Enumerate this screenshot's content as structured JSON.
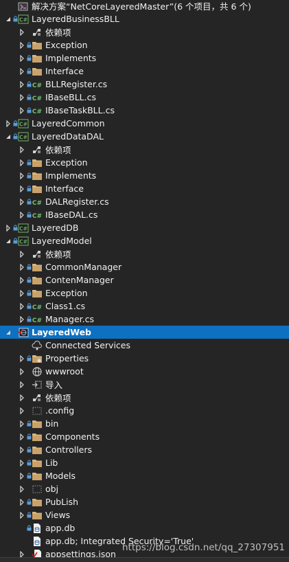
{
  "colors": {
    "background": "#252526",
    "selection": "#0e70c0",
    "folder": "#dcb67a",
    "csharp": "#6fc36f",
    "project": "#68a063"
  },
  "watermark": "https://blog.csdn.net/qq_27307951",
  "tree": [
    {
      "label": "解决方案“NetCoreLayeredMaster”(6 个项目，共 6 个)",
      "icon": "solution-icon",
      "depth": 0,
      "arrow": "none",
      "lock": false
    },
    {
      "label": "LayeredBusinessBLL",
      "icon": "csharp-project-icon",
      "depth": 0,
      "arrow": "expanded",
      "lock": true
    },
    {
      "label": "依赖项",
      "icon": "dependencies-icon",
      "depth": 1,
      "arrow": "collapsed",
      "lock": false
    },
    {
      "label": "Exception",
      "icon": "folder-icon",
      "depth": 1,
      "arrow": "collapsed",
      "lock": true
    },
    {
      "label": "Implements",
      "icon": "folder-icon",
      "depth": 1,
      "arrow": "collapsed",
      "lock": true
    },
    {
      "label": "Interface",
      "icon": "folder-icon",
      "depth": 1,
      "arrow": "collapsed",
      "lock": true
    },
    {
      "label": "BLLRegister.cs",
      "icon": "csharp-file-icon",
      "depth": 1,
      "arrow": "collapsed",
      "lock": true
    },
    {
      "label": "IBaseBLL.cs",
      "icon": "csharp-file-icon",
      "depth": 1,
      "arrow": "collapsed",
      "lock": true
    },
    {
      "label": "IBaseTaskBLL.cs",
      "icon": "csharp-file-icon",
      "depth": 1,
      "arrow": "collapsed",
      "lock": true
    },
    {
      "label": "LayeredCommon",
      "icon": "csharp-project-icon",
      "depth": 0,
      "arrow": "collapsed",
      "lock": true
    },
    {
      "label": "LayeredDataDAL",
      "icon": "csharp-project-icon",
      "depth": 0,
      "arrow": "expanded",
      "lock": true
    },
    {
      "label": "依赖项",
      "icon": "dependencies-icon",
      "depth": 1,
      "arrow": "collapsed",
      "lock": false
    },
    {
      "label": "Exception",
      "icon": "folder-icon",
      "depth": 1,
      "arrow": "collapsed",
      "lock": true
    },
    {
      "label": "Implements",
      "icon": "folder-icon",
      "depth": 1,
      "arrow": "collapsed",
      "lock": true
    },
    {
      "label": "Interface",
      "icon": "folder-icon",
      "depth": 1,
      "arrow": "collapsed",
      "lock": true
    },
    {
      "label": "DALRegister.cs",
      "icon": "csharp-file-icon",
      "depth": 1,
      "arrow": "collapsed",
      "lock": true
    },
    {
      "label": "IBaseDAL.cs",
      "icon": "csharp-file-icon",
      "depth": 1,
      "arrow": "collapsed",
      "lock": true
    },
    {
      "label": "LayeredDB",
      "icon": "csharp-project-icon",
      "depth": 0,
      "arrow": "collapsed",
      "lock": true
    },
    {
      "label": "LayeredModel",
      "icon": "csharp-project-icon",
      "depth": 0,
      "arrow": "expanded",
      "lock": true
    },
    {
      "label": "依赖项",
      "icon": "dependencies-icon",
      "depth": 1,
      "arrow": "collapsed",
      "lock": false
    },
    {
      "label": "CommonManager",
      "icon": "folder-icon",
      "depth": 1,
      "arrow": "collapsed",
      "lock": true
    },
    {
      "label": "ContenManager",
      "icon": "folder-icon",
      "depth": 1,
      "arrow": "collapsed",
      "lock": true
    },
    {
      "label": "Exception",
      "icon": "folder-icon",
      "depth": 1,
      "arrow": "collapsed",
      "lock": true
    },
    {
      "label": "Class1.cs",
      "icon": "csharp-file-icon",
      "depth": 1,
      "arrow": "collapsed",
      "lock": true
    },
    {
      "label": "Manager.cs",
      "icon": "csharp-file-icon",
      "depth": 1,
      "arrow": "collapsed",
      "lock": true
    },
    {
      "label": "LayeredWeb",
      "icon": "web-project-icon",
      "depth": 0,
      "arrow": "expanded",
      "lock": false,
      "selected": true
    },
    {
      "label": "Connected Services",
      "icon": "connected-services-icon",
      "depth": 1,
      "arrow": "none",
      "lock": false
    },
    {
      "label": "Properties",
      "icon": "properties-folder-icon",
      "depth": 1,
      "arrow": "collapsed",
      "lock": true
    },
    {
      "label": "wwwroot",
      "icon": "globe-icon",
      "depth": 1,
      "arrow": "collapsed",
      "lock": false
    },
    {
      "label": "导入",
      "icon": "import-icon",
      "depth": 1,
      "arrow": "collapsed",
      "lock": false
    },
    {
      "label": "依赖项",
      "icon": "dependencies-icon",
      "depth": 1,
      "arrow": "collapsed",
      "lock": false
    },
    {
      "label": ".config",
      "icon": "excluded-folder-icon",
      "depth": 1,
      "arrow": "collapsed",
      "lock": false
    },
    {
      "label": "bin",
      "icon": "folder-icon",
      "depth": 1,
      "arrow": "collapsed",
      "lock": true
    },
    {
      "label": "Components",
      "icon": "folder-icon",
      "depth": 1,
      "arrow": "collapsed",
      "lock": true
    },
    {
      "label": "Controllers",
      "icon": "folder-icon",
      "depth": 1,
      "arrow": "collapsed",
      "lock": true
    },
    {
      "label": "Lib",
      "icon": "folder-icon",
      "depth": 1,
      "arrow": "collapsed",
      "lock": true
    },
    {
      "label": "Models",
      "icon": "folder-icon",
      "depth": 1,
      "arrow": "collapsed",
      "lock": true
    },
    {
      "label": "obj",
      "icon": "excluded-folder-icon",
      "depth": 1,
      "arrow": "collapsed",
      "lock": false
    },
    {
      "label": "PubLish",
      "icon": "folder-icon",
      "depth": 1,
      "arrow": "collapsed",
      "lock": true
    },
    {
      "label": "Views",
      "icon": "folder-icon",
      "depth": 1,
      "arrow": "collapsed",
      "lock": true
    },
    {
      "label": "app.db",
      "icon": "database-file-icon",
      "depth": 1,
      "arrow": "none",
      "lock": true
    },
    {
      "label": "app.db; Integrated Security='True'",
      "icon": "database-file-icon",
      "depth": 1,
      "arrow": "none",
      "lock": false
    },
    {
      "label": "appsettings.json",
      "icon": "json-file-icon",
      "depth": 1,
      "arrow": "collapsed",
      "lock": false
    }
  ]
}
